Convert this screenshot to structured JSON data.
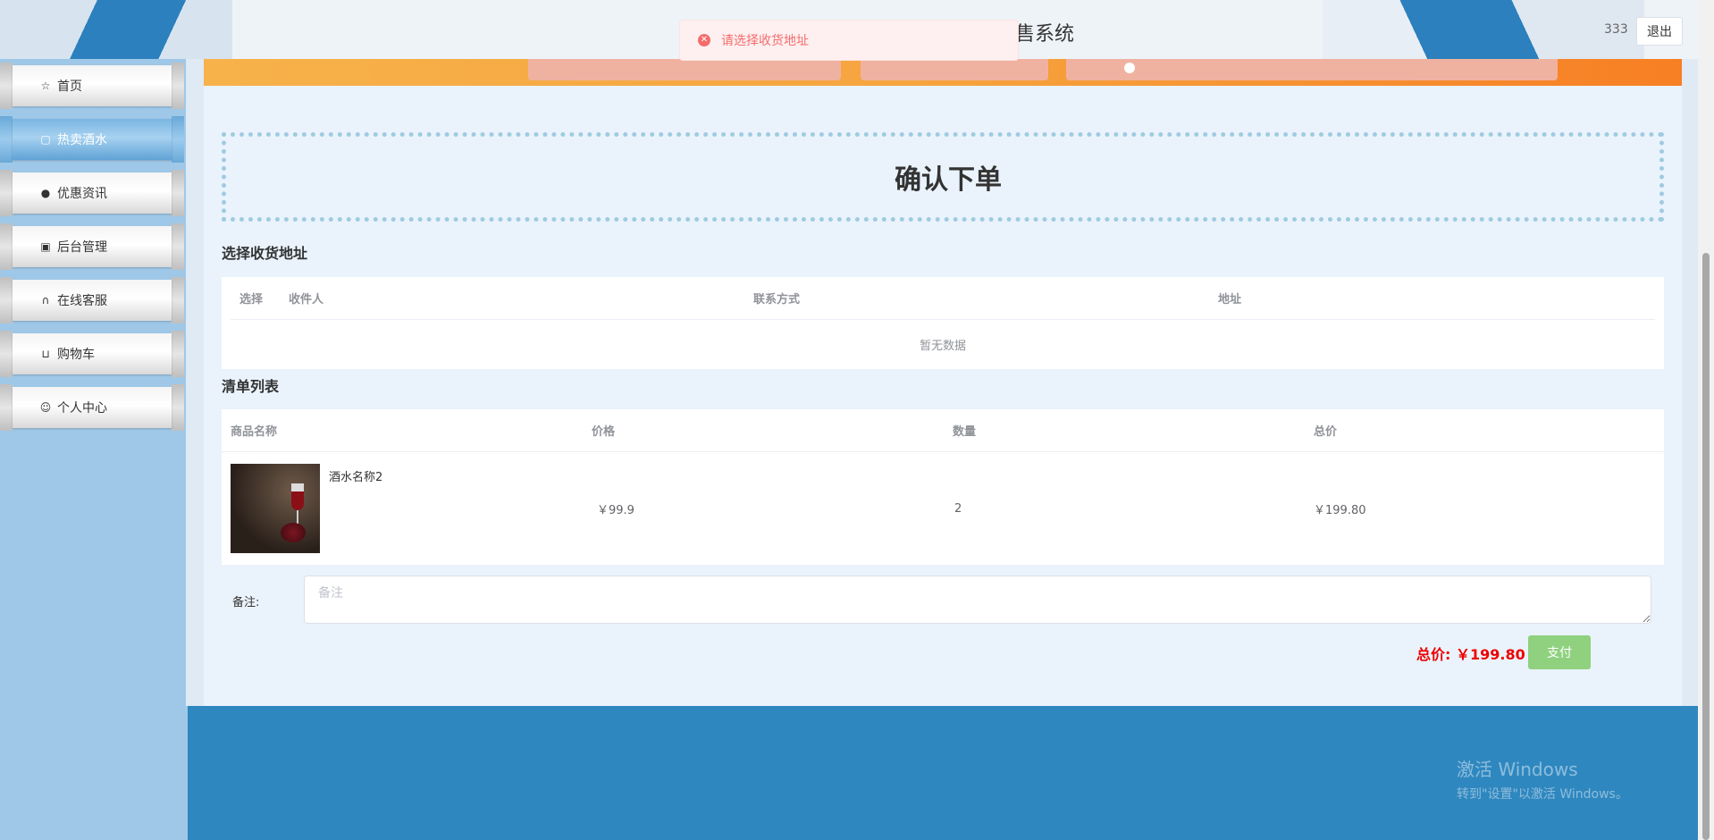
{
  "header": {
    "site_title": "售系统",
    "username": "333",
    "logout_label": "退出"
  },
  "toast": {
    "message": "请选择收货地址",
    "icon": "error-circle-icon"
  },
  "sidebar": {
    "items": [
      {
        "label": "首页",
        "icon": "star-icon"
      },
      {
        "label": "热卖酒水",
        "icon": "bag-icon",
        "active": true
      },
      {
        "label": "优惠资讯",
        "icon": "info-icon"
      },
      {
        "label": "后台管理",
        "icon": "briefcase-icon"
      },
      {
        "label": "在线客服",
        "icon": "headset-icon"
      },
      {
        "label": "购物车",
        "icon": "cart-icon"
      },
      {
        "label": "个人中心",
        "icon": "user-icon"
      }
    ]
  },
  "page": {
    "title": "确认下单"
  },
  "address": {
    "section_label": "选择收货地址",
    "columns": [
      "选择",
      "收件人",
      "联系方式",
      "地址"
    ],
    "empty_text": "暂无数据"
  },
  "order_list": {
    "section_label": "清单列表",
    "columns": [
      "商品名称",
      "价格",
      "数量",
      "总价"
    ],
    "rows": [
      {
        "name": "酒水名称2",
        "price": "￥99.9",
        "quantity": "2",
        "total": "￥199.80"
      }
    ]
  },
  "remark": {
    "label": "备注:",
    "placeholder": "备注"
  },
  "summary": {
    "total_text": "总价: ￥199.80",
    "pay_label": "支付"
  },
  "watermark": {
    "line1": "激活 Windows",
    "line2": "转到\"设置\"以激活 Windows。"
  },
  "colors": {
    "accent": "#2f87bf",
    "sidebar": "#9fc8e8",
    "error": "#f56c6c",
    "pay": "#8fd17e",
    "price_red": "#ee0000"
  }
}
